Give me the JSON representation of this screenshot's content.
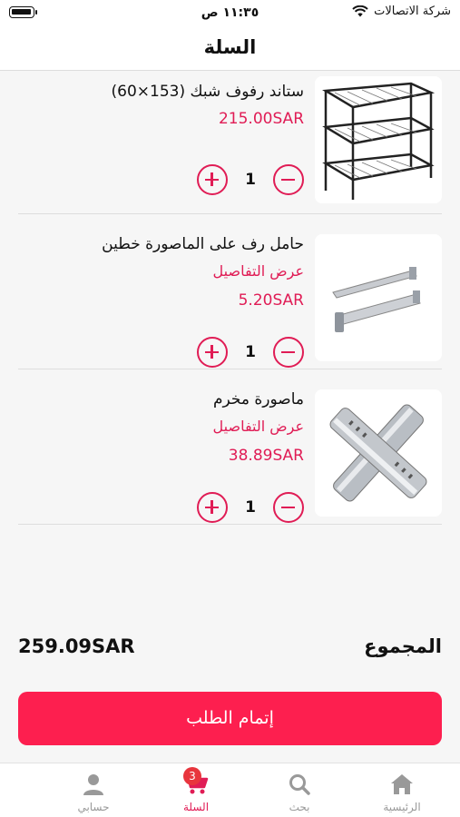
{
  "status_bar": {
    "carrier": "شركة الاتصالات",
    "time": "١١:٣٥ ص"
  },
  "header": {
    "title": "السلة"
  },
  "cart": {
    "items": [
      {
        "name": "ستاند رفوف شبك (153×60)",
        "details": "",
        "price": "215.00SAR",
        "quantity": "1"
      },
      {
        "name": "حامل رف على الماصورة خطين",
        "details": "عرض التفاصيل",
        "price": "5.20SAR",
        "quantity": "1"
      },
      {
        "name": "ماصورة مخرم",
        "details": "عرض التفاصيل",
        "price": "38.89SAR",
        "quantity": "1"
      }
    ]
  },
  "summary": {
    "total_label": "المجموع",
    "total_amount": "259.09SAR"
  },
  "checkout": {
    "label": "إتمام الطلب"
  },
  "tabs": [
    {
      "label": "الرئيسية",
      "icon": "home-icon"
    },
    {
      "label": "بحث",
      "icon": "search-icon"
    },
    {
      "label": "السلة",
      "icon": "cart-icon",
      "badge": "3"
    },
    {
      "label": "حسابي",
      "icon": "user-icon"
    }
  ],
  "colors": {
    "accent": "#e01c55",
    "button": "#fd1f4f",
    "badge": "#e8353d"
  }
}
